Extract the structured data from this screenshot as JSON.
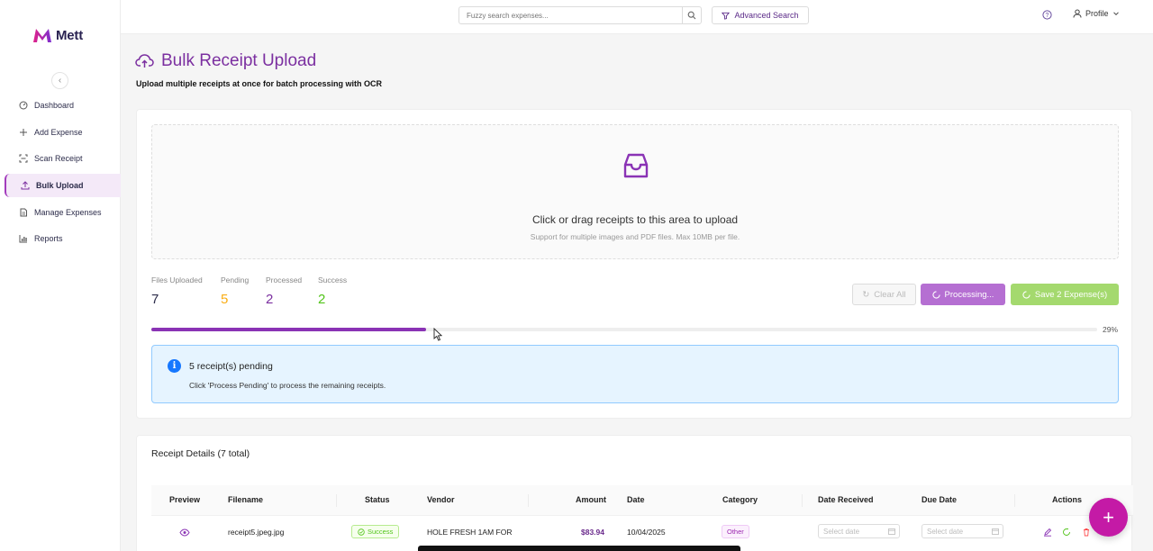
{
  "app": {
    "name": "Mett"
  },
  "colors": {
    "brand": "#7b2fa0",
    "accent": "#a33cbd",
    "success": "#52c41a",
    "info": "#1677ff",
    "fab": "#c41aa6"
  },
  "sidebar": {
    "collapse_icon": "chevron-left-icon",
    "items": [
      {
        "label": "Dashboard",
        "icon": "dashboard-icon",
        "active": false
      },
      {
        "label": "Add Expense",
        "icon": "plus-icon",
        "active": false
      },
      {
        "label": "Scan Receipt",
        "icon": "scan-icon",
        "active": false
      },
      {
        "label": "Bulk Upload",
        "icon": "upload-icon",
        "active": true
      },
      {
        "label": "Manage Expenses",
        "icon": "file-icon",
        "active": false
      },
      {
        "label": "Reports",
        "icon": "bar-chart-icon",
        "active": false
      }
    ]
  },
  "topbar": {
    "search_placeholder": "Fuzzy search expenses...",
    "advanced_search_label": "Advanced Search",
    "profile_label": "Profile"
  },
  "page": {
    "title": "Bulk Receipt Upload",
    "subtitle": "Upload multiple receipts at once for batch processing with OCR"
  },
  "dropzone": {
    "title": "Click or drag receipts to this area to upload",
    "hint": "Support for multiple images and PDF files. Max 10MB per file."
  },
  "stats": {
    "files_uploaded": {
      "label": "Files Uploaded",
      "value": "7"
    },
    "pending": {
      "label": "Pending",
      "value": "5"
    },
    "processed": {
      "label": "Processed",
      "value": "2"
    },
    "success": {
      "label": "Success",
      "value": "2"
    }
  },
  "actions": {
    "clear_all": "Clear All",
    "processing": "Processing...",
    "save": "Save 2 Expense(s)"
  },
  "progress": {
    "percent": 29,
    "label": "29%"
  },
  "alert": {
    "title": "5 receipt(s) pending",
    "description": "Click 'Process Pending' to process the remaining receipts."
  },
  "details": {
    "title": "Receipt Details (7 total)",
    "columns": [
      "Preview",
      "Filename",
      "Status",
      "Vendor",
      "Amount",
      "Date",
      "Category",
      "Date Received",
      "Due Date",
      "Actions"
    ],
    "rows": [
      {
        "filename": "receipt5.jpeg.jpg",
        "status": "Success",
        "vendor": "HOLE FRESH 1AM FOR",
        "amount": "$83.94",
        "date": "10/04/2025",
        "category": "Other",
        "date_received_placeholder": "Select date",
        "due_date_placeholder": "Select date"
      }
    ]
  },
  "fab": {
    "label": "+"
  }
}
